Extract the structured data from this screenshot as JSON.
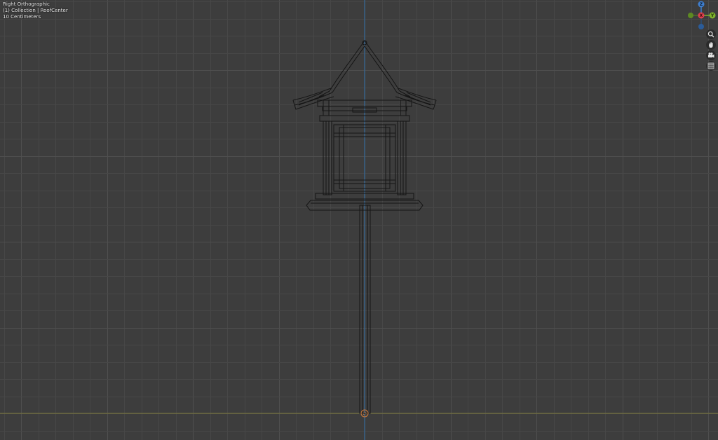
{
  "viewport": {
    "view_name": "Right Orthographic",
    "collection_line": "(1) Collection | RoofCenter",
    "scale_line": "10 Centimeters"
  },
  "colors": {
    "background": "#3d3d3d",
    "grid_minor": "#474747",
    "grid_major": "#4f4f4f",
    "axis_vertical": "#2e6da8",
    "axis_horizontal": "#7c7a3a",
    "wire": "#111111",
    "gizmo_x": "#e0404e",
    "gizmo_y": "#7fb32c",
    "gizmo_z": "#3f7fd0"
  },
  "gizmo": {
    "z_label": "Z",
    "y_label": "Y",
    "x_label": "X"
  },
  "nav_tools": [
    {
      "name": "zoom-icon"
    },
    {
      "name": "pan-hand-icon"
    },
    {
      "name": "camera-view-icon"
    },
    {
      "name": "ortho-grid-icon"
    }
  ]
}
